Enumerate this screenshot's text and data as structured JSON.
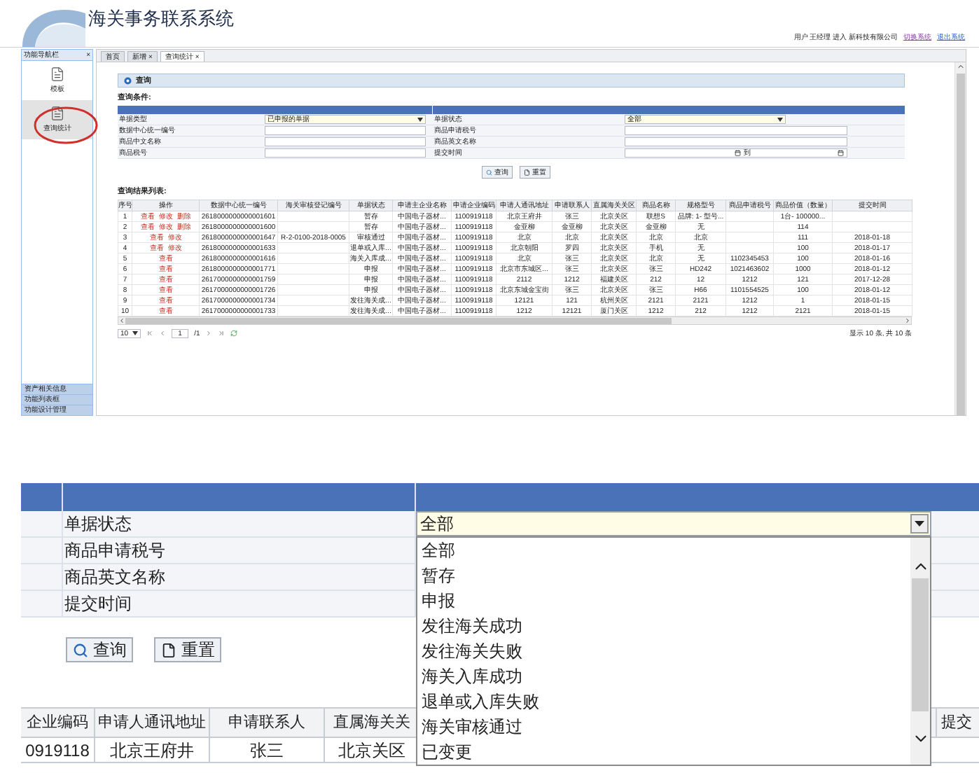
{
  "app": {
    "title": "海关事务联系系统",
    "user_info": "用户 王经理 进入 新科技有限公司",
    "header_links": [
      {
        "label": "切换系统",
        "kind": "visited"
      },
      {
        "label": "退出系统",
        "kind": "normal"
      }
    ],
    "sidebar": {
      "title": "功能导航栏",
      "close": "×",
      "items": [
        {
          "label": "模板",
          "selected": false,
          "circled": false
        },
        {
          "label": "查询统计",
          "selected": true,
          "circled": true
        }
      ],
      "bottom_items": [
        "资产相关信息",
        "功能列表框",
        "功能设计管理"
      ]
    },
    "tabs": [
      {
        "label": "首页",
        "closable": false,
        "selected": false
      },
      {
        "label": "新增",
        "closable": true,
        "selected": false
      },
      {
        "label": "查询统计",
        "closable": true,
        "selected": true
      }
    ],
    "close_glyph": "×",
    "panel_title": "查询",
    "conditions_title": "查询条件:",
    "fields": [
      [
        {
          "label": "单据类型",
          "kind": "select",
          "value": "已申报的单据"
        },
        {
          "label": "单据状态",
          "kind": "select",
          "value": "全部"
        }
      ],
      [
        {
          "label": "数据中心统一编号",
          "kind": "text"
        },
        {
          "label": "商品申请税号",
          "kind": "text"
        }
      ],
      [
        {
          "label": "商品中文名称",
          "kind": "text"
        },
        {
          "label": "商品英文名称",
          "kind": "text"
        }
      ],
      [
        {
          "label": "商品税号",
          "kind": "text"
        },
        {
          "label": "提交时间",
          "kind": "date",
          "separator": "到"
        }
      ]
    ],
    "buttons": [
      "查询",
      "重置"
    ],
    "results_title": "查询结果列表:",
    "columns": [
      "序号",
      "操作",
      "数据中心统一编号",
      "海关审核登记编号",
      "单据状态",
      "申请主企业名称",
      "申请企业编码",
      "申请人通讯地址",
      "申请联系人",
      "直属海关关区",
      "商品名称",
      "规格型号",
      "商品申请税号",
      "商品价值（数量）",
      "提交时间"
    ],
    "rows": [
      {
        "cells": [
          "1",
          [
            "查看",
            "修改",
            "删除"
          ],
          "2618000000000001601",
          "",
          "暂存",
          "中国电子器材...",
          "1100919118",
          "北京王府井",
          "张三",
          "北京关区",
          "联想S",
          "品牌: 1- 型号...",
          "",
          "1台- 100000...",
          ""
        ]
      },
      {
        "cells": [
          "2",
          [
            "查看",
            "修改",
            "删除"
          ],
          "2618000000000001600",
          "",
          "暂存",
          "中国电子器材...",
          "1100919118",
          "金亚柳",
          "金亚柳",
          "北京关区",
          "金亚柳",
          "无",
          "",
          "114",
          ""
        ]
      },
      {
        "cells": [
          "3",
          [
            "查看",
            "修改"
          ],
          "2618000000000001647",
          "R-2-0100-2018-0005",
          "审核通过",
          "中国电子器材...",
          "1100919118",
          "北京",
          "北京",
          "北京关区",
          "北京",
          "北京",
          "",
          "111",
          "2018-01-18"
        ]
      },
      {
        "cells": [
          "4",
          [
            "查看",
            "修改"
          ],
          "2618000000000001633",
          "",
          "退单或入库...",
          "中国电子器材...",
          "1100919118",
          "北京朝阳",
          "罗四",
          "北京关区",
          "手机",
          "无",
          "",
          "100",
          "2018-01-17"
        ]
      },
      {
        "cells": [
          "5",
          [
            "查看"
          ],
          "2618000000000001616",
          "",
          "海关入库成...",
          "中国电子器材...",
          "1100919118",
          "北京",
          "张三",
          "北京关区",
          "北京",
          "无",
          "1102345453",
          "100",
          "2018-01-16"
        ]
      },
      {
        "cells": [
          "6",
          [
            "查看"
          ],
          "2618000000000001771",
          "",
          "申报",
          "中国电子器材...",
          "1100919118",
          "北京市东城区...",
          "张三",
          "北京关区",
          "张三",
          "HD242",
          "1021463602",
          "1000",
          "2018-01-12"
        ]
      },
      {
        "cells": [
          "7",
          [
            "查看"
          ],
          "2617000000000001759",
          "",
          "申报",
          "中国电子器材...",
          "1100919118",
          "2112",
          "1212",
          "福建关区",
          "212",
          "12",
          "1212",
          "121",
          "2017-12-28"
        ]
      },
      {
        "cells": [
          "8",
          [
            "查看"
          ],
          "2617000000000001726",
          "",
          "申报",
          "中国电子器材...",
          "1100919118",
          "北京东城金宝街",
          "张三",
          "北京关区",
          "张三",
          "H66",
          "1101554525",
          "100",
          "2018-01-12"
        ]
      },
      {
        "cells": [
          "9",
          [
            "查看"
          ],
          "2617000000000001734",
          "",
          "发往海关成...",
          "中国电子器材...",
          "1100919118",
          "12121",
          "121",
          "杭州关区",
          "2121",
          "2121",
          "1212",
          "1",
          "2018-01-15"
        ]
      },
      {
        "cells": [
          "10",
          [
            "查看"
          ],
          "2617000000000001733",
          "",
          "发往海关成...",
          "中国电子器材...",
          "1100919118",
          "1212",
          "12121",
          "厦门关区",
          "1212",
          "212",
          "1212",
          "2121",
          "2018-01-15"
        ]
      }
    ],
    "pager": {
      "page_size": "10",
      "page": "1",
      "total": "/1",
      "summary": "显示 10 条, 共 10 条"
    }
  },
  "detail": {
    "fields": [
      {
        "label": "单据状态",
        "kind": "select",
        "value": "全部"
      },
      {
        "label": "商品申请税号"
      },
      {
        "label": "商品英文名称"
      },
      {
        "label": "提交时间"
      }
    ],
    "options": [
      "全部",
      "暂存",
      "申报",
      "发往海关成功",
      "发往海关失败",
      "海关入库成功",
      "退单或入库失败",
      "海关审核通过",
      "已变更"
    ],
    "buttons": [
      "查询",
      "重置"
    ],
    "columns": [
      "企业编码",
      "申请人通讯地址",
      "申请联系人",
      "直属海关关",
      "提交"
    ],
    "row": [
      "0919118",
      "北京王府井",
      "张三",
      "北京关区"
    ]
  }
}
